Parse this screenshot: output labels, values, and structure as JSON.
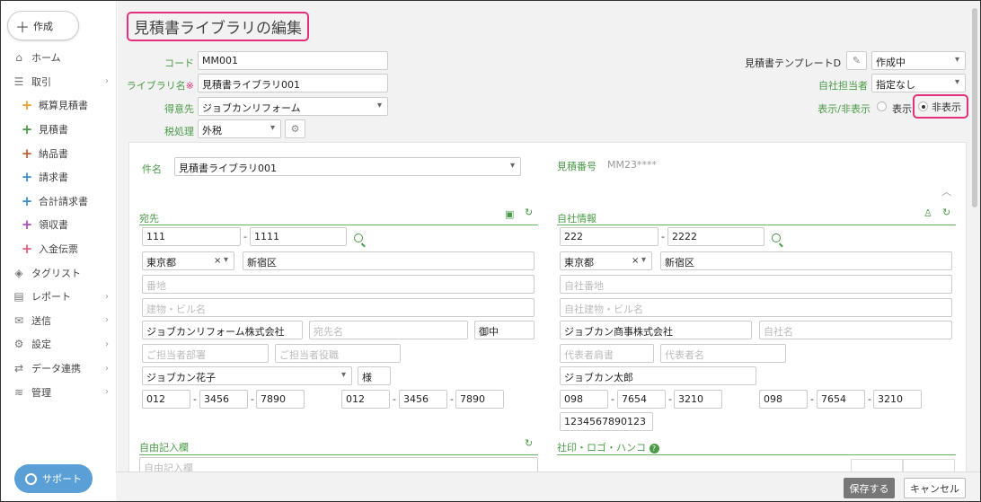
{
  "sidebar": {
    "create_label": "作成",
    "items": [
      {
        "label": "ホーム",
        "icon": "home-icon"
      },
      {
        "label": "取引",
        "icon": "list-icon"
      },
      {
        "label": "概算見積書",
        "color": "#f0a030"
      },
      {
        "label": "見積書",
        "color": "#4a9b47"
      },
      {
        "label": "納品書",
        "color": "#c0603a"
      },
      {
        "label": "請求書",
        "color": "#3a8fd0"
      },
      {
        "label": "合計請求書",
        "color": "#3a8fd0"
      },
      {
        "label": "領収書",
        "color": "#b050c0"
      },
      {
        "label": "入金伝票",
        "color": "#e06080"
      },
      {
        "label": "タグリスト",
        "icon": "tag-icon"
      },
      {
        "label": "レポート",
        "icon": "report-icon"
      },
      {
        "label": "送信",
        "icon": "mail-icon"
      },
      {
        "label": "設定",
        "icon": "gear-icon"
      },
      {
        "label": "データ連携",
        "icon": "sync-icon"
      },
      {
        "label": "管理",
        "icon": "layers-icon"
      }
    ],
    "support_label": "サポート"
  },
  "header": {
    "title": "見積書ライブラリの編集",
    "code_label": "コード",
    "code_value": "MM001",
    "library_label": "ライブラリ名",
    "library_required": "※",
    "library_value": "見積書ライブラリ001",
    "customer_label": "得意先",
    "customer_value": "ジョブカンリフォーム",
    "tax_label": "税処理",
    "tax_value": "外税",
    "template_label": "見積書テンプレートD",
    "status_value": "作成中",
    "owner_label": "自社担当者",
    "owner_value": "指定なし",
    "visibility_label": "表示/非表示",
    "visibility_show": "表示",
    "visibility_hide": "非表示"
  },
  "panel": {
    "subject_label": "件名",
    "subject_value": "見積書ライブラリ001",
    "estimate_no_label": "見積番号",
    "estimate_no_value": "MM23****",
    "dest": {
      "title": "宛先",
      "zip1": "111",
      "zip2": "1111",
      "pref": "東京都",
      "city": "新宿区",
      "addr_ph": "番地",
      "bldg_ph": "建物・ビル名",
      "company": "ジョブカンリフォーム株式会社",
      "dest_name_ph": "宛先名",
      "honorific": "御中",
      "dept_ph": "ご担当者部署",
      "position_ph": "ご担当者役職",
      "person": "ジョブカン花子",
      "person_honorific": "様",
      "tel": [
        "012",
        "3456",
        "7890"
      ],
      "fax": [
        "012",
        "3456",
        "7890"
      ]
    },
    "own": {
      "title": "自社情報",
      "zip1": "222",
      "zip2": "2222",
      "pref": "東京都",
      "city": "新宿区",
      "addr_ph": "自社番地",
      "bldg_ph": "自社建物・ビル名",
      "company": "ジョブカン商事株式会社",
      "name_ph": "自社名",
      "rep_title_ph": "代表者肩書",
      "rep_name_ph": "代表者名",
      "rep": "ジョブカン太郎",
      "tel": [
        "098",
        "7654",
        "3210"
      ],
      "fax": [
        "098",
        "7654",
        "3210"
      ],
      "reg_no": "1234567890123"
    },
    "free_title": "自由記入欄",
    "free_ph": "自由記入欄",
    "stamp_title": "社印・ロゴ・ハンコ"
  },
  "footer": {
    "save": "保存する",
    "cancel": "キャンセル"
  }
}
